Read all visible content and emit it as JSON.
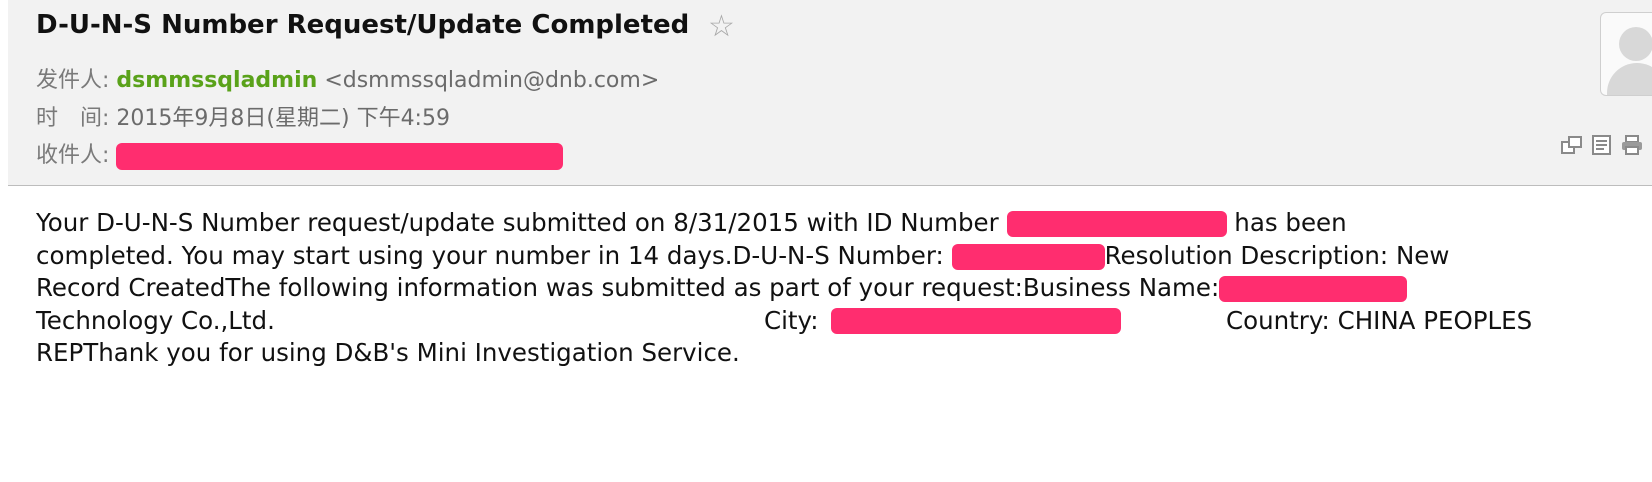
{
  "email": {
    "subject": "D-U-N-S Number Request/Update Completed",
    "star_icon": "☆",
    "from_label": "发件人:",
    "from_name": "dsmmssqladmin",
    "from_address": "<dsmmssqladmin@dnb.com>",
    "time_label": "时　间:",
    "time_value": "2015年9月8日(星期二) 下午4:59",
    "to_label": "收件人:"
  },
  "icons": [
    "star-icon",
    "avatar-icon",
    "new-window-icon",
    "plain-text-icon",
    "print-icon"
  ],
  "colors": {
    "redaction": "#ff2d6f",
    "sender_name": "#5aa21a",
    "header_bg": "#f2f2f2"
  },
  "body": {
    "l1a": "Your D-U-N-S Number request/update submitted on 8/31/2015 with ID Number",
    "l1b": "has been",
    "l2a": "completed.  You may start using your number in 14 days.D-U-N-S Number:",
    "l2b": "Resolution Description: New",
    "l3a": "Record CreatedThe following information was submitted as part of your request:Business Name:",
    "l4a": "Technology Co.,Ltd.",
    "l4b": "City:",
    "l4c": "Country: CHINA PEOPLES",
    "l5a": "REPThank you for using D&B's Mini Investigation Service."
  }
}
